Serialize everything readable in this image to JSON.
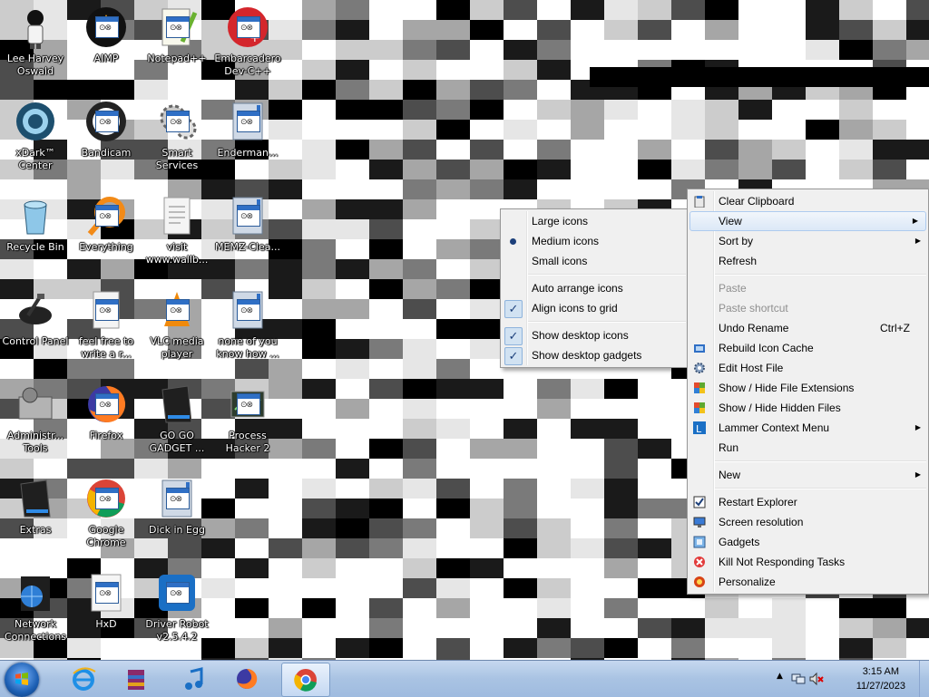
{
  "desktop_icons": [
    {
      "name": "lee-harvey-oswald",
      "label": "Lee Harvey\nOswald",
      "icon": "character-figure-icon"
    },
    {
      "name": "aimp",
      "label": "AIMP",
      "icon": "aimp-icon"
    },
    {
      "name": "notepadpp",
      "label": "Notepad++",
      "icon": "notepad-plus-icon"
    },
    {
      "name": "embarcadero-devcpp",
      "label": "Embarcadero\nDev-C++",
      "icon": "devcpp-icon"
    },
    {
      "name": "xdark-center",
      "label": "xDark™\nCenter",
      "icon": "xdark-icon"
    },
    {
      "name": "bandicam",
      "label": "Bandicam",
      "icon": "bandicam-icon"
    },
    {
      "name": "smart-services",
      "label": "Smart\nServices",
      "icon": "gears-icon"
    },
    {
      "name": "enderman",
      "label": "Enderman...",
      "icon": "app-window-icon"
    },
    {
      "name": "recycle-bin",
      "label": "Recycle Bin",
      "icon": "recycle-bin-icon"
    },
    {
      "name": "everything",
      "label": "Everything",
      "icon": "search-magnifier-icon"
    },
    {
      "name": "visit-wallb",
      "label": "visit\nwww.wallb...",
      "icon": "document-icon"
    },
    {
      "name": "memz-clean",
      "label": "MEMZ-Clea...",
      "icon": "app-window-icon"
    },
    {
      "name": "control-panel",
      "label": "Control Panel",
      "icon": "control-panel-icon"
    },
    {
      "name": "feel-free",
      "label": "feel free to\nwrite a r...",
      "icon": "document-icon"
    },
    {
      "name": "vlc",
      "label": "VLC media\nplayer",
      "icon": "vlc-cone-icon"
    },
    {
      "name": "none-of-you",
      "label": "none of you\nknow how ...",
      "icon": "app-window-icon"
    },
    {
      "name": "administrative-tools",
      "label": "Administr...\nTools",
      "icon": "tools-icon"
    },
    {
      "name": "firefox",
      "label": "Firefox",
      "icon": "firefox-icon"
    },
    {
      "name": "go-go-gadget",
      "label": "GO GO\nGADGET ...",
      "icon": "folder-dark-icon"
    },
    {
      "name": "process-hacker",
      "label": "Process\nHacker 2",
      "icon": "process-hacker-icon"
    },
    {
      "name": "extras",
      "label": "Extras",
      "icon": "folder-dark-icon"
    },
    {
      "name": "google-chrome",
      "label": "Google\nChrome",
      "icon": "chrome-icon"
    },
    {
      "name": "dick-in-egg",
      "label": "Dick in Egg",
      "icon": "app-window-icon"
    },
    {
      "name": "network-connections",
      "label": "Network\nConnections",
      "icon": "network-globe-icon"
    },
    {
      "name": "hxd",
      "label": "HxD",
      "icon": "hxd-icon"
    },
    {
      "name": "driver-robot",
      "label": "Driver Robot\nv2.5.4.2",
      "icon": "driver-robot-icon"
    }
  ],
  "view_menu": {
    "items": [
      {
        "label": "Large icons",
        "state": ""
      },
      {
        "label": "Medium icons",
        "state": "radio"
      },
      {
        "label": "Small icons",
        "state": ""
      },
      {
        "separator": true
      },
      {
        "label": "Auto arrange icons",
        "state": ""
      },
      {
        "label": "Align icons to grid",
        "state": "check"
      },
      {
        "separator": true
      },
      {
        "label": "Show desktop icons",
        "state": "check"
      },
      {
        "label": "Show desktop gadgets",
        "state": "check"
      }
    ]
  },
  "context_menu": {
    "items": [
      {
        "label": "Clear Clipboard",
        "icon": "clipboard-icon"
      },
      {
        "label": "View",
        "submenu": true,
        "hover": true
      },
      {
        "label": "Sort by",
        "submenu": true
      },
      {
        "label": "Refresh"
      },
      {
        "separator": true
      },
      {
        "label": "Paste",
        "disabled": true
      },
      {
        "label": "Paste shortcut",
        "disabled": true
      },
      {
        "label": "Undo Rename",
        "shortcut": "Ctrl+Z"
      },
      {
        "label": "Rebuild Icon Cache",
        "icon": "rebuild-cache-icon"
      },
      {
        "label": "Edit Host File",
        "icon": "gear-icon"
      },
      {
        "label": "Show / Hide File Extensions",
        "icon": "shield-icon"
      },
      {
        "label": "Show / Hide Hidden Files",
        "icon": "shield-icon"
      },
      {
        "label": "Lammer Context Menu",
        "icon": "lammer-l-icon",
        "submenu": true
      },
      {
        "label": "Run"
      },
      {
        "separator": true
      },
      {
        "label": "New",
        "submenu": true
      },
      {
        "separator": true
      },
      {
        "label": "Restart Explorer",
        "icon": "checkbox-icon"
      },
      {
        "label": "Screen resolution",
        "icon": "monitor-icon"
      },
      {
        "label": "Gadgets",
        "icon": "gadgets-icon"
      },
      {
        "label": "Kill Not Responding Tasks",
        "icon": "kill-task-icon"
      },
      {
        "label": "Personalize",
        "icon": "personalize-icon"
      }
    ]
  },
  "taskbar": {
    "buttons": [
      {
        "name": "internet-explorer",
        "icon": "ie-icon"
      },
      {
        "name": "winrar",
        "icon": "archive-icon"
      },
      {
        "name": "music",
        "icon": "music-note-icon"
      },
      {
        "name": "firefox",
        "icon": "firefox-icon"
      },
      {
        "name": "chrome",
        "icon": "chrome-icon",
        "active": true
      }
    ],
    "clock": {
      "time": "3:15 AM",
      "date": "11/27/2023"
    }
  }
}
